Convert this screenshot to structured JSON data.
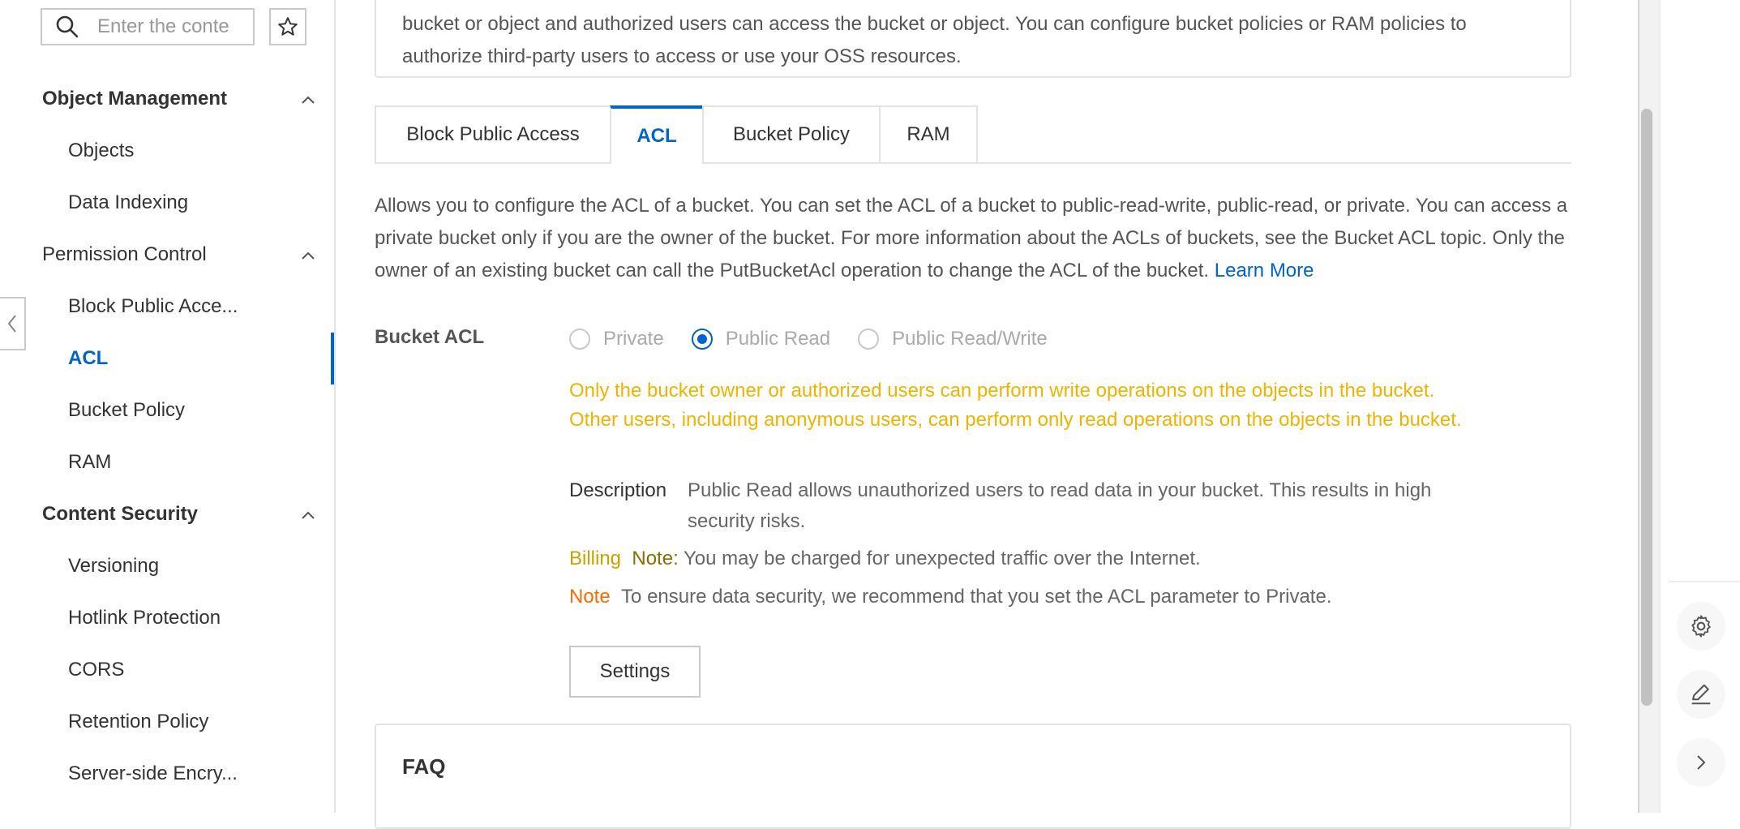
{
  "sidebar": {
    "search_placeholder": "Enter the conte",
    "groups": [
      {
        "title": "Object Management",
        "items": [
          "Objects",
          "Data Indexing"
        ]
      },
      {
        "title": "Permission Control",
        "items": [
          "Block Public Acce...",
          "ACL",
          "Bucket Policy",
          "RAM"
        ]
      },
      {
        "title": "Content Security",
        "items": [
          "Versioning",
          "Hotlink Protection",
          "CORS",
          "Retention Policy",
          "Server-side Encry..."
        ]
      }
    ],
    "active_item": "ACL"
  },
  "top_card": {
    "line1": "bucket or object and authorized users can access the bucket or object. You can configure bucket policies or RAM policies to",
    "line2": "authorize third-party users to access or use your OSS resources."
  },
  "tabs": [
    "Block Public Access",
    "ACL",
    "Bucket Policy",
    "RAM"
  ],
  "active_tab": "ACL",
  "description": {
    "text": "Allows you to configure the ACL of a bucket. You can set the ACL of a bucket to public-read-write, public-read, or private. You can access a private bucket only if you are the owner of the bucket. For more information about the ACLs of buckets, see the Bucket ACL topic. Only the owner of an existing bucket can call the PutBucketAcl operation to change the ACL of the bucket.",
    "link": "Learn More"
  },
  "bucket_acl": {
    "label": "Bucket ACL",
    "options": [
      "Private",
      "Public Read",
      "Public Read/Write"
    ],
    "selected": "Public Read",
    "warning": "Only the bucket owner or authorized users can perform write operations on the objects in the bucket. Other users, including anonymous users, can perform only read operations on the objects in the bucket.",
    "description_key": "Description",
    "description_value": "Public Read allows unauthorized users to read data in your bucket. This results in high security risks.",
    "billing_key": "Billing",
    "billing_note_label": "Note:",
    "billing_value": "You may be charged for unexpected traffic over the Internet.",
    "note_key": "Note",
    "note_value": "To ensure data security, we recommend that you set the ACL parameter to Private.",
    "settings_button": "Settings"
  },
  "faq": {
    "title": "FAQ"
  },
  "icons": {
    "search": "search-icon",
    "star": "star-icon",
    "collapse": "chevron-left-icon",
    "settings": "gear-icon",
    "edit": "edit-icon",
    "expand": "chevron-right-icon"
  },
  "colors": {
    "accent": "#0064c8",
    "warning": "#f0b400",
    "note": "#ff6a00"
  }
}
